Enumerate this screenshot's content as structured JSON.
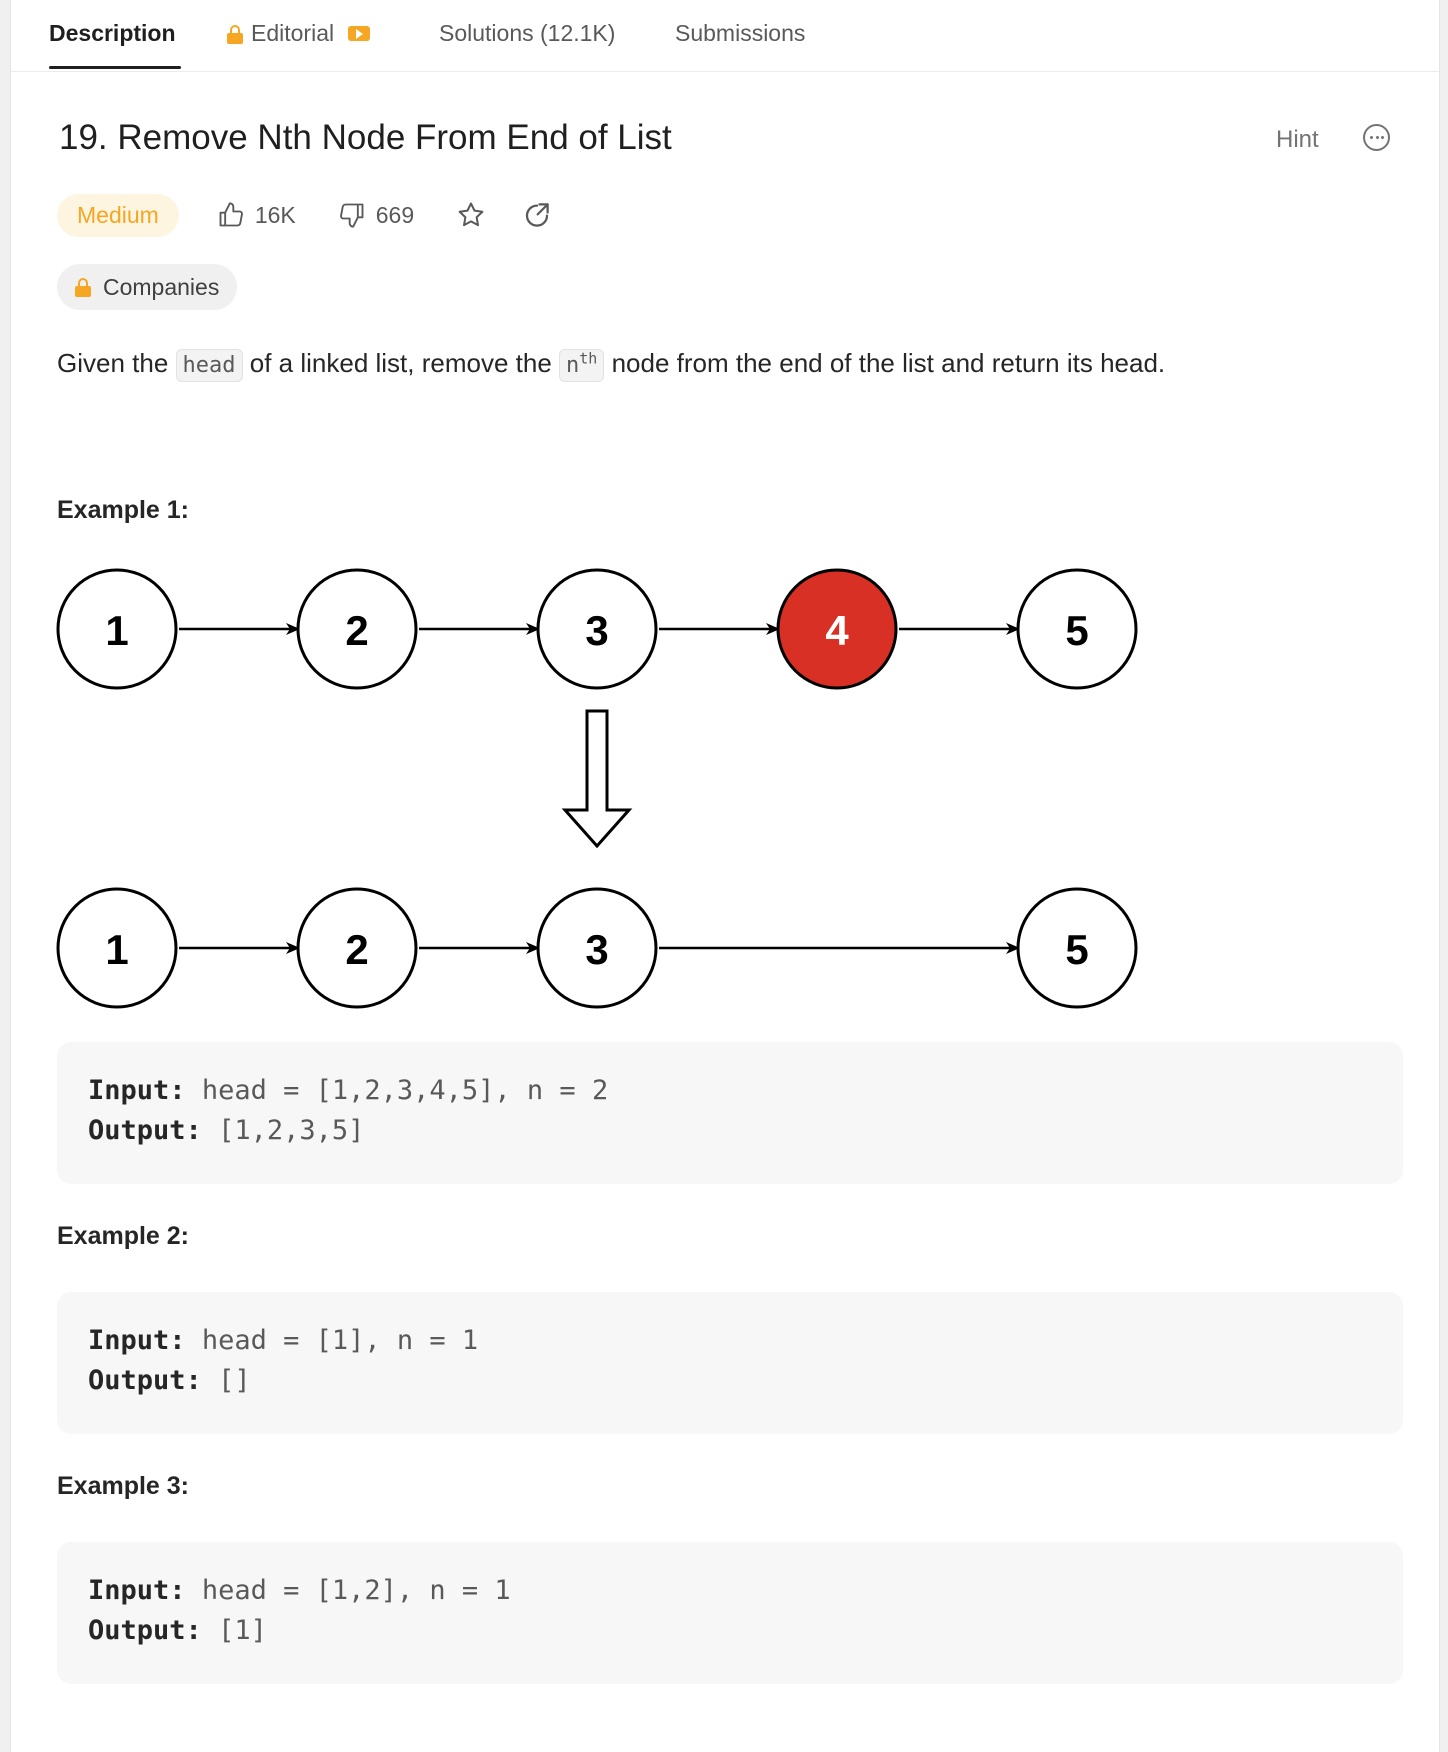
{
  "tabs": {
    "description": "Description",
    "editorial": "Editorial",
    "solutions": "Solutions (12.1K)",
    "submissions": "Submissions"
  },
  "problem": {
    "title": "19. Remove Nth Node From End of List",
    "difficulty": "Medium",
    "likes": "16K",
    "dislikes": "669",
    "hint_label": "Hint",
    "companies_label": "Companies",
    "description": {
      "part1": "Given the",
      "code_head": "head",
      "part2": "of a linked list, remove the",
      "code_n": "n",
      "code_th": "th",
      "part3": "node from the end of the list and return its head."
    }
  },
  "diagram": {
    "before_nodes": [
      "1",
      "2",
      "3",
      "4",
      "5"
    ],
    "removed_node": "4",
    "after_nodes": [
      "1",
      "2",
      "3",
      "5"
    ],
    "removed_color": "#d93025"
  },
  "examples": [
    {
      "title": "Example 1:",
      "input_label": "Input:",
      "input": "head = [1,2,3,4,5], n = 2",
      "output_label": "Output:",
      "output": "[1,2,3,5]"
    },
    {
      "title": "Example 2:",
      "input_label": "Input:",
      "input": "head = [1], n = 1",
      "output_label": "Output:",
      "output": "[]"
    },
    {
      "title": "Example 3:",
      "input_label": "Input:",
      "input": "head = [1,2], n = 1",
      "output_label": "Output:",
      "output": "[1]"
    }
  ],
  "colors": {
    "accent_difficulty": "#f5a623",
    "lock": "#f5a623"
  }
}
